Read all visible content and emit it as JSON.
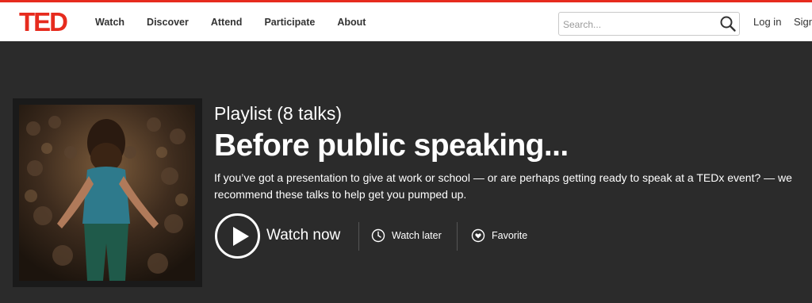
{
  "header": {
    "logo": "TED",
    "nav": [
      "Watch",
      "Discover",
      "Attend",
      "Participate",
      "About"
    ],
    "search_placeholder": "Search...",
    "login_label": "Log in",
    "signup_label": "Sign"
  },
  "playlist": {
    "eyebrow": "Playlist (8 talks)",
    "title": "Before public speaking...",
    "description": "If you’ve got a presentation to give at work or school — or are perhaps getting ready to speak at a TEDx event? — we recommend these talks to help get you pumped up.",
    "watch_now_label": "Watch now",
    "watch_later_label": "Watch later",
    "favorite_label": "Favorite"
  },
  "icons": {
    "search": "search-icon",
    "play": "play-icon",
    "clock": "clock-icon",
    "heart": "heart-icon"
  },
  "colors": {
    "brand_red": "#e62b1e",
    "hero_bg": "#2b2b2b",
    "header_bg": "#ffffff"
  }
}
